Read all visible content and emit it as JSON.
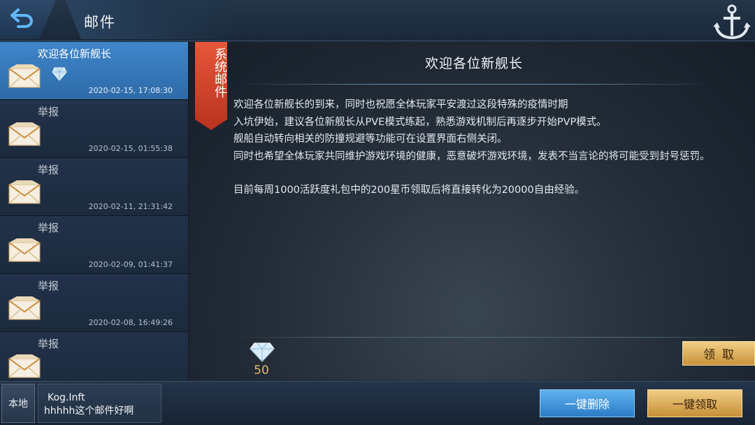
{
  "header": {
    "title": "邮件",
    "back_icon": "back-arrow-icon",
    "logo_icon": "anchor-icon"
  },
  "mail_list": [
    {
      "subject": "欢迎各位新舰长",
      "date": "2020-02-15, 17:08:30",
      "selected": true,
      "has_attachment": true
    },
    {
      "subject": "举报",
      "date": "2020-02-15, 01:55:38",
      "selected": false,
      "has_attachment": false
    },
    {
      "subject": "举报",
      "date": "2020-02-11, 21:31:42",
      "selected": false,
      "has_attachment": false
    },
    {
      "subject": "举报",
      "date": "2020-02-09, 01:41:37",
      "selected": false,
      "has_attachment": false
    },
    {
      "subject": "举报",
      "date": "2020-02-08, 16:49:26",
      "selected": false,
      "has_attachment": false
    },
    {
      "subject": "举报",
      "date": "",
      "selected": false,
      "has_attachment": false
    }
  ],
  "detail": {
    "ribbon_label": "系统邮件",
    "title": "欢迎各位新舰长",
    "paragraphs": [
      "欢迎各位新舰长的到来，同时也祝愿全体玩家平安渡过这段特殊的疫情时期",
      "入坑伊始，建议各位新舰长从PVE模式练起，熟悉游戏机制后再逐步开始PVP模式。",
      "舰船自动转向相关的防撞规避等功能可在设置界面右侧关闭。",
      "同时也希望全体玩家共同维护游戏环境的健康，恶意破坏游戏环境，发表不当言论的将可能受到封号惩罚。",
      "",
      "目前每周1000活跃度礼包中的200星币领取后将直接转化为20000自由经验。"
    ],
    "reward": {
      "icon": "diamond-icon",
      "count": "50"
    },
    "claim_label": "领取"
  },
  "footer": {
    "local_tab": "本地",
    "chat_user": "Kog.Inft",
    "chat_message": "hhhhh这个邮件好啊",
    "delete_all_label": "一键删除",
    "claim_all_label": "一键领取"
  },
  "colors": {
    "selected_item": "#3f86c9",
    "ribbon": "#d8442b",
    "gold_button": "#e0b060",
    "blue_button": "#4a9ee0"
  }
}
